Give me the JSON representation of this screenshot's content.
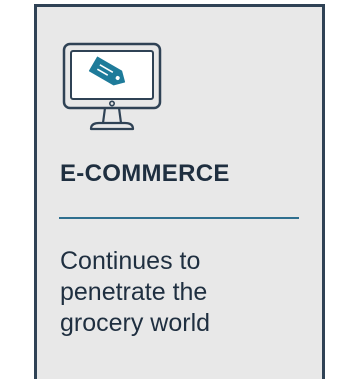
{
  "card": {
    "icon": "monitor-with-price-tag-icon",
    "title": "E-COMMERCE",
    "description_lines": [
      "Continues to",
      "penetrate the",
      "grocery world"
    ]
  },
  "colors": {
    "card_background": "#e8e8e8",
    "border": "#2f4255",
    "text": "#1f2f40",
    "divider": "#2f6f8f",
    "tag": "#1e7b9a"
  }
}
